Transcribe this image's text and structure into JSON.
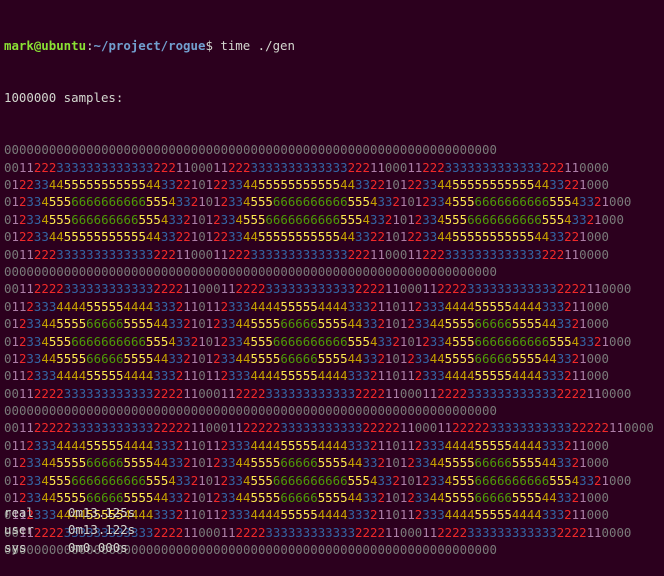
{
  "terminal": {
    "prompt": {
      "user_host": "mark@ubuntu",
      "sep": ":",
      "path": "~/project/rogue",
      "symbol": "$",
      "command": " time ./gen"
    },
    "samples_line": "1000000 samples:",
    "grid_rows": [
      "000000000000000000000000000000000000000000000000000000000000000000",
      "001122233333333333332221100011222333333333333322211000112223333333333333222110000",
      "012233445555555555544332210122334455555555555443322101223344555555555554433221000",
      "012334555666666666655543321012334555666666666655543321012334555666666666655543321000",
      "01233455566666666655543321012334555666666666655543321012334555666666666655543321000",
      "012233445555555555544332210122334455555555555443322101223344555555555554433221000",
      "001122233333333333332221100011222333333333333322211000112223333333333333222110000",
      "000000000000000000000000000000000000000000000000000000000000000000",
      "001122223333333333332222110001122223333333333332222110001122223333333333332222110000",
      "011233344445555544443332110112333444455555444433321101123334444555554444333211000",
      "012334455556666655554433210123344555566666555544332101233445555666665555443321000",
      "012334555666666666655543321012334555666666666655543321012334555666666666655543321000",
      "012334455556666655554433210123344555566666555544332101233445555666665555443321000",
      "011233344445555544443332110112333444455555444433321101123334444555554444333211000",
      "001122223333333333332222110001122223333333333332222110001122223333333333332222110000",
      "000000000000000000000000000000000000000000000000000000000000000000",
      "001122222333333333332222211000112222233333333333222221100011222223333333333322222110000",
      "011233344445555544443332110112333444455555444433321101123334444555554444333211000",
      "012334455556666655554433210123344555566666555544332101233445555666665555443321000",
      "012334555666666666655543321012334555666666666655543321012334555666666666655543321000",
      "012334455556666655554433210123344555566666555544332101233445555666665555443321000",
      "011233344445555544443332110112333444455555444433321101123334444555554444333211000",
      "001122223333333333332222110001122223333333333332222110001122223333333333332222110000",
      "000000000000000000000000000000000000000000000000000000000000000000"
    ],
    "timing": [
      {
        "label": "real",
        "value": "0m13.125s"
      },
      {
        "label": "user",
        "value": "0m13.122s"
      },
      {
        "label": "sys",
        "value": "0m0.000s"
      }
    ]
  }
}
